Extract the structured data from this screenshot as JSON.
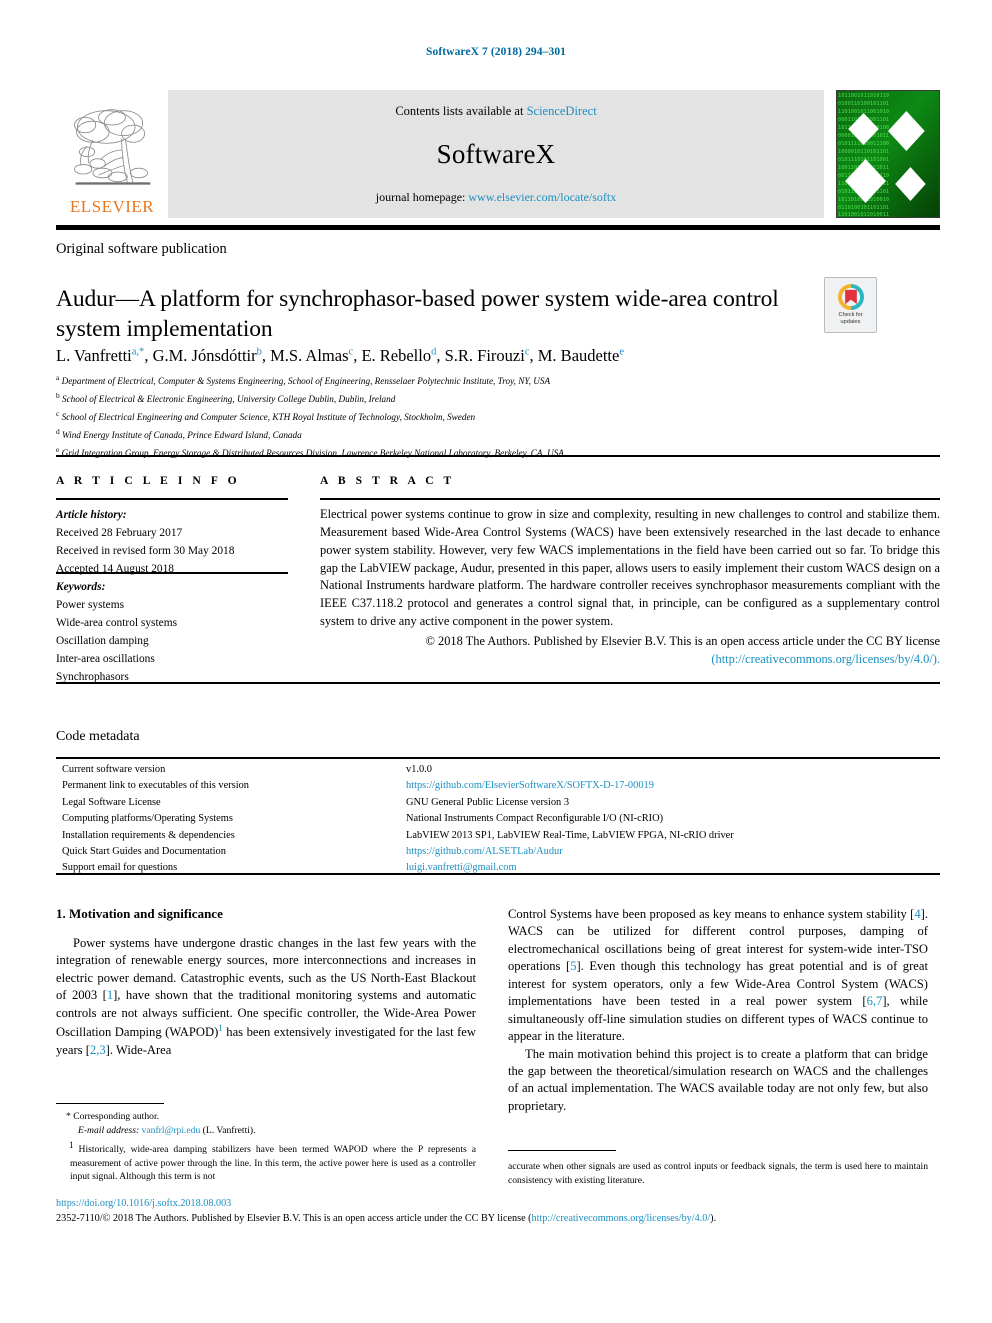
{
  "running_head": "SoftwareX 7 (2018) 294–301",
  "masthead": {
    "publisher_name": "ELSEVIER",
    "publisher_logo_icon": "elsevier-tree-icon",
    "contents_prefix": "Contents lists available at ",
    "contents_link": "ScienceDirect",
    "journal_name": "SoftwareX",
    "homepage_prefix": "journal homepage: ",
    "homepage_url": "www.elsevier.com/locate/softx",
    "cover_icon": "journal-cover-binary-diamonds"
  },
  "article": {
    "type": "Original software publication",
    "title": "Audur—A platform for synchrophasor-based power system wide-area control system implementation",
    "crossmark": {
      "label_line1": "Check for",
      "label_line2": "updates",
      "icon": "crossmark-badge-icon"
    }
  },
  "authors": [
    {
      "name": "L. Vanfretti",
      "marks": "a,*"
    },
    {
      "name": "G.M. Jónsdóttir",
      "marks": "b"
    },
    {
      "name": "M.S. Almas",
      "marks": "c"
    },
    {
      "name": "E. Rebello",
      "marks": "d"
    },
    {
      "name": "S.R. Firouzi",
      "marks": "c"
    },
    {
      "name": "M. Baudette",
      "marks": "e"
    }
  ],
  "affiliations": [
    {
      "mark": "a",
      "text": "Department of Electrical, Computer & Systems Engineering, School of Engineering, Rensselaer Polytechnic Institute, Troy, NY, USA"
    },
    {
      "mark": "b",
      "text": "School of Electrical & Electronic Engineering, University College Dublin, Dublin, Ireland"
    },
    {
      "mark": "c",
      "text": "School of Electrical Engineering and Computer Science, KTH Royal Institute of Technology, Stockholm, Sweden"
    },
    {
      "mark": "d",
      "text": "Wind Energy Institute of Canada, Prince Edward Island, Canada"
    },
    {
      "mark": "e",
      "text": "Grid Integration Group, Energy Storage & Distributed Resources Division, Lawrence Berkeley National Laboratory, Berkeley, CA, USA"
    }
  ],
  "article_info": {
    "heading": "A R T I C L E   I N F O",
    "history_label": "Article history:",
    "history": [
      "Received 28 February 2017",
      "Received in revised form 30 May 2018",
      "Accepted 14 August 2018"
    ],
    "keywords_label": "Keywords:",
    "keywords": [
      "Power systems",
      "Wide-area control systems",
      "Oscillation damping",
      "Inter-area oscillations",
      "Synchrophasors"
    ]
  },
  "abstract": {
    "heading": "A B S T R A C T",
    "body": "Electrical power systems continue to grow in size and complexity, resulting in new challenges to control and stabilize them. Measurement based Wide-Area Control Systems (WACS) have been extensively researched in the last decade to enhance power system stability. However, very few WACS implementations in the field have been carried out so far. To bridge this gap the LabVIEW package, Audur, presented in this paper, allows users to easily implement their custom WACS design on a National Instruments hardware platform. The hardware controller receives synchrophasor measurements compliant with the IEEE C37.118.2 protocol and generates a control signal that, in principle, can be configured as a supplementary control system to drive any active component in the power system.",
    "copyright": "© 2018 The Authors. Published by Elsevier B.V. This is an open access article under the CC BY license",
    "license_url": "(http://creativecommons.org/licenses/by/4.0/)."
  },
  "code_metadata": {
    "title": "Code metadata",
    "rows": [
      {
        "key": "Current software version",
        "value": "v1.0.0",
        "is_link": false
      },
      {
        "key": "Permanent link to executables of this version",
        "value": "https://github.com/ElsevierSoftwareX/SOFTX-D-17-00019",
        "is_link": true
      },
      {
        "key": "Legal Software License",
        "value": "GNU General Public License version 3",
        "is_link": false
      },
      {
        "key": "Computing platforms/Operating Systems",
        "value": "National Instruments Compact Reconfigurable I/O (NI-cRIO)",
        "is_link": false
      },
      {
        "key": "Installation requirements & dependencies",
        "value": "LabVIEW 2013 SP1, LabVIEW Real-Time, LabVIEW FPGA, NI-cRIO driver",
        "is_link": false
      },
      {
        "key": "Quick Start Guides and Documentation",
        "value": "https://github.com/ALSETLab/Audur",
        "is_link": true
      },
      {
        "key": "Support email for questions",
        "value": "luigi.vanfretti@gmail.com",
        "is_link": true
      }
    ]
  },
  "body": {
    "section_heading": "1. Motivation and significance",
    "left_paragraph": "Power systems have undergone drastic changes in the last few years with the integration of renewable energy sources, more interconnections and increases in electric power demand. Catastrophic events, such as the US North-East Blackout of 2003 [1], have shown that the traditional monitoring systems and automatic controls are not always sufficient. One specific controller, the Wide-Area Power Oscillation Damping (WAPOD)1 has been extensively investigated for the last few years [2,3]. Wide-Area",
    "right_paragraph_1": "Control Systems have been proposed as key means to enhance system stability [4]. WACS can be utilized for different control purposes, damping of electromechanical oscillations being of great interest for system-wide inter-TSO operations [5]. Even though this technology has great potential and is of great interest for system operators, only a few Wide-Area Control System (WACS) implementations have been tested in a real power system [6,7], while simultaneously off-line simulation studies on different types of WACS continue to appear in the literature.",
    "right_paragraph_2": "The main motivation behind this project is to create a platform that can bridge the gap between the theoretical/simulation research on WACS and the challenges of an actual implementation. The WACS available today are not only few, but also proprietary."
  },
  "footnotes": {
    "corresponding_marker": "*",
    "corresponding_label": "Corresponding author.",
    "email_label": "E-mail address:",
    "email": "vanfrl@rpi.edu",
    "email_owner": "(L. Vanfretti).",
    "note1_marker": "1",
    "note1_left": "Historically, wide-area damping stabilizers have been termed WAPOD where the P represents a measurement of active power through the line. In this term, the active power here is used as a controller input signal. Although this term is not",
    "note1_right": "accurate when other signals are used as control inputs or feedback signals, the term is used here to maintain consistency with existing literature."
  },
  "page_footer": {
    "doi": "https://doi.org/10.1016/j.softx.2018.08.003",
    "issn_line": "2352-7110/© 2018 The Authors. Published by Elsevier B.V. This is an open access article under the CC BY license (",
    "license_url": "http://creativecommons.org/licenses/by/4.0/",
    "issn_tail": ")."
  },
  "colors": {
    "link": "#1a8fc4",
    "elsevier_orange": "#e87722",
    "band_gray": "#e3e3e3",
    "cover_green": "#0a7a12"
  }
}
